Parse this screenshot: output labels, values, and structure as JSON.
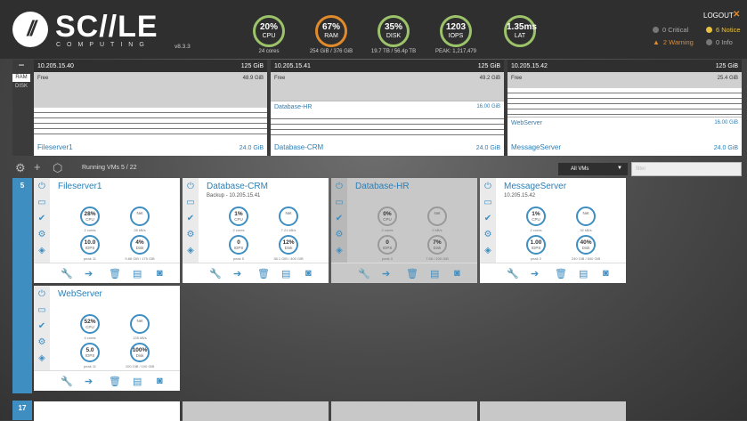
{
  "header": {
    "brand": "SC//LE",
    "brand_sub": "COMPUTING",
    "version": "v8.3.3",
    "gauges": [
      {
        "value": "20%",
        "label": "CPU",
        "caption": "24 cores",
        "color": "#9cc36a"
      },
      {
        "value": "67%",
        "label": "RAM",
        "caption": "254 GiB / 376 GiB",
        "color": "#e08a2c"
      },
      {
        "value": "35%",
        "label": "DISK",
        "caption": "19.7 TB / 56.4p TB",
        "color": "#9cc36a"
      },
      {
        "value": "1203",
        "label": "IOPS",
        "caption": "PEAK: 1,217,479",
        "color": "#9cc36a"
      },
      {
        "value": "1.35ms",
        "label": "LAT",
        "caption": "",
        "color": "#9cc36a"
      }
    ],
    "logout": "LOGOUT",
    "alerts": {
      "critical": "0 Critical",
      "notice": "6 Notice",
      "warning": "2 Warning",
      "info": "0 Info"
    }
  },
  "summary": {
    "collapse_icon": "−",
    "toggle": [
      "RAM",
      "DISK"
    ],
    "nodes": [
      {
        "ip": "10.205.15.40",
        "total": "125 GiB",
        "free_label": "Free",
        "free_value": "48.9 GiB",
        "vms": [],
        "big_vm": {
          "name": "Fileserver1",
          "size": "24.0 GiB"
        }
      },
      {
        "ip": "10.205.15.41",
        "total": "125 GiB",
        "free_label": "Free",
        "free_value": "49.2 GiB",
        "vms": [
          {
            "name": "Database-HR",
            "size": "16.00 GiB"
          }
        ],
        "big_vm": {
          "name": "Database-CRM",
          "size": "24.0 GiB"
        }
      },
      {
        "ip": "10.205.15.42",
        "total": "125 GiB",
        "free_label": "Free",
        "free_value": "25.4 GiB",
        "vms": [
          {
            "name": "WebServer",
            "size": "16.00 GiB"
          }
        ],
        "big_vm": {
          "name": "MessageServer",
          "size": "24.0 GiB"
        }
      }
    ]
  },
  "toolbar": {
    "running": "Running VMs 5 / 22",
    "filter_select": "All VMs",
    "filter_placeholder": "filter"
  },
  "groups": [
    {
      "label": "5"
    },
    {
      "label": "17"
    }
  ],
  "vms": [
    {
      "name": "Fileserver1",
      "subtitle": "",
      "off": false,
      "metrics": [
        {
          "v": "28%",
          "l": "CPU",
          "c": "2 cores"
        },
        {
          "v": "",
          "l": "Net",
          "c": "28 kB/s"
        },
        {
          "v": "10.0",
          "l": "IOPS",
          "c": "peak 11"
        },
        {
          "v": "4%",
          "l": "Disk",
          "c": "9.88 GiB / 175 GiB"
        }
      ]
    },
    {
      "name": "Database-CRM",
      "subtitle": "Backup - 10.205.15.41",
      "off": false,
      "metrics": [
        {
          "v": "1%",
          "l": "CPU",
          "c": "2 cores"
        },
        {
          "v": "",
          "l": "Net",
          "c": "7.21 kB/s"
        },
        {
          "v": "0",
          "l": "IOPS",
          "c": "peak 5"
        },
        {
          "v": "12%",
          "l": "Disk",
          "c": "38.1 GiB / 400 GiB"
        }
      ]
    },
    {
      "name": "Database-HR",
      "subtitle": "",
      "off": true,
      "metrics": [
        {
          "v": "0%",
          "l": "CPU",
          "c": "2 cores"
        },
        {
          "v": "",
          "l": "Net",
          "c": "0 kB/s"
        },
        {
          "v": "0",
          "l": "IOPS",
          "c": "peak 0"
        },
        {
          "v": "7%",
          "l": "Disk",
          "c": "7.56 / 100 GiB"
        }
      ]
    },
    {
      "name": "MessageServer",
      "subtitle": "10.205.15.42",
      "off": false,
      "metrics": [
        {
          "v": "1%",
          "l": "CPU",
          "c": "2 cores"
        },
        {
          "v": "",
          "l": "Net",
          "c": "32 kB/s"
        },
        {
          "v": "1.00",
          "l": "IOPS",
          "c": "peak 2"
        },
        {
          "v": "40%",
          "l": "Disk",
          "c": "240 GiB / 600 GiB"
        }
      ]
    },
    {
      "name": "WebServer",
      "subtitle": "",
      "off": false,
      "metrics": [
        {
          "v": "52%",
          "l": "CPU",
          "c": "4 cores"
        },
        {
          "v": "",
          "l": "Net",
          "c": "128 kB/s"
        },
        {
          "v": "5.0",
          "l": "IOPS",
          "c": "peak 11"
        },
        {
          "v": "100%",
          "l": "Disk",
          "c": "100 GiB / 100 GiB"
        }
      ]
    }
  ],
  "card_icons": {
    "side": [
      "power-icon",
      "console-icon",
      "check-icon",
      "settings-icon",
      "layers-icon"
    ],
    "bottom": [
      "wrench-icon",
      "move-icon",
      "trash-icon",
      "snapshot-icon",
      "camera-icon"
    ]
  },
  "colors": {
    "accent": "#3f8ec1",
    "header_bg": "#2f2f2f",
    "warning": "#e08a2c",
    "notice": "#e8c040",
    "vm_name": "#2b7fb6"
  }
}
